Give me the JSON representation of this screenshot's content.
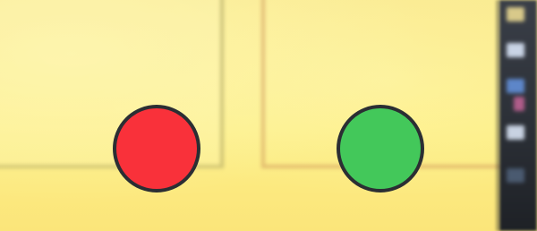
{
  "scene": {
    "background_color": "#fbe98a",
    "sidebar_color": "#2a2e35"
  },
  "targets": [
    {
      "name": "red-circle",
      "color": "#f9313a",
      "border_color": "#2b2e33"
    },
    {
      "name": "green-circle",
      "color": "#43c85a",
      "border_color": "#2b2e33"
    }
  ]
}
